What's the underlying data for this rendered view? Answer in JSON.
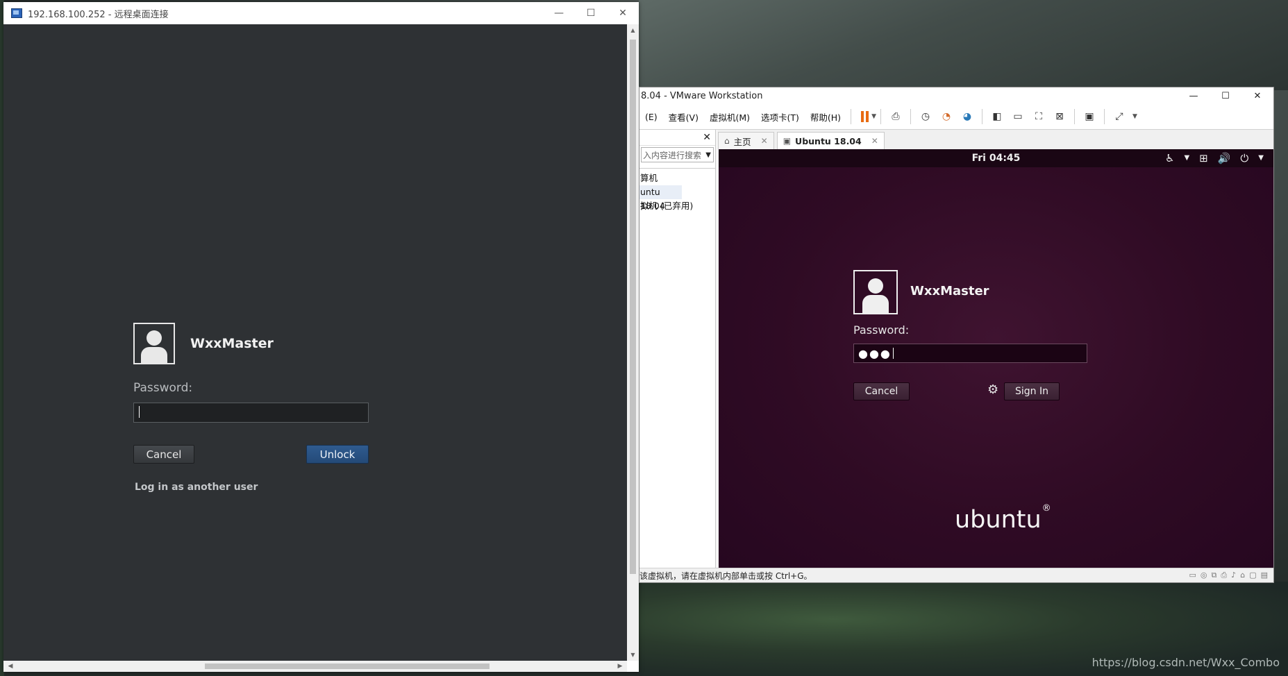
{
  "rdp": {
    "title": "192.168.100.252 - 远程桌面连接",
    "window_buttons": {
      "minimize": "—",
      "maximize": "☐",
      "close": "✕"
    },
    "login": {
      "username": "WxxMaster",
      "password_label": "Password:",
      "password_value": "",
      "cancel": "Cancel",
      "unlock": "Unlock",
      "other_user": "Log in as another user"
    },
    "accent": "#244a78"
  },
  "vmware": {
    "title": "8.04 - VMware Workstation",
    "window_buttons": {
      "minimize": "—",
      "maximize": "☐",
      "close": "✕"
    },
    "menu": [
      "(E)",
      "查看(V)",
      "虚拟机(M)",
      "选项卡(T)",
      "帮助(H)"
    ],
    "library": {
      "close": "✕",
      "search_placeholder": "入内容进行搜索",
      "tree": [
        "算机",
        "untu 18.04",
        "拟机 (已弃用)"
      ]
    },
    "tabs": [
      {
        "label": "主页",
        "icon": "home-icon"
      },
      {
        "label": "Ubuntu 18.04",
        "icon": "vm-icon"
      }
    ],
    "guest": {
      "clock": "Fri 04:45",
      "username": "WxxMaster",
      "password_label": "Password:",
      "password_mask": "●●●",
      "cancel": "Cancel",
      "sign_in": "Sign In",
      "logo_text": "ubuntu",
      "background": "#2f0b24"
    },
    "status_text": "该虚拟机，请在虚拟机内部单击或按 Ctrl+G。"
  },
  "watermark": "https://blog.csdn.net/Wxx_Combo"
}
